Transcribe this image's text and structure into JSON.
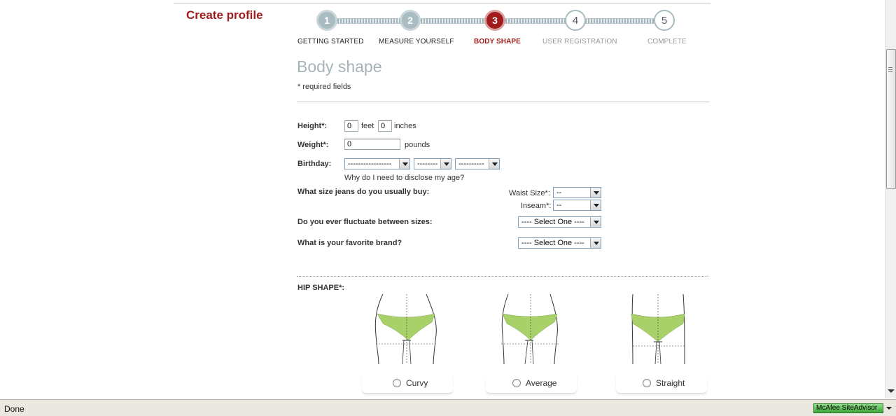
{
  "page": {
    "create_title": "Create profile",
    "section_title": "Body shape",
    "required_note": "* required fields"
  },
  "steps": [
    {
      "number": "1",
      "label": "GETTING STARTED",
      "state": "done"
    },
    {
      "number": "2",
      "label": "MEASURE YOURSELF",
      "state": "done"
    },
    {
      "number": "3",
      "label": "BODY SHAPE",
      "state": "active"
    },
    {
      "number": "4",
      "label": "USER REGISTRATION",
      "state": "todo"
    },
    {
      "number": "5",
      "label": "COMPLETE",
      "state": "todo"
    }
  ],
  "form": {
    "height_label": "Height*:",
    "height_feet_value": "0",
    "feet_unit": "feet",
    "height_inches_value": "0",
    "inches_unit": "inches",
    "weight_label": "Weight*:",
    "weight_value": "0",
    "weight_unit": "pounds",
    "birthday_label": "Birthday:",
    "birthday_month": "-----------------",
    "birthday_day": "--------",
    "birthday_year": "----------",
    "age_link": "Why do I need to disclose my age?",
    "jeans_label": "What size jeans do you usually buy:",
    "waist_label": "Waist Size*:",
    "waist_value": "--",
    "inseam_label": "Inseam*:",
    "inseam_value": "--",
    "fluctuate_label": "Do you ever fluctuate between sizes:",
    "fluctuate_value": "---- Select One ----",
    "brand_label": "What is your favorite brand?",
    "brand_value": "---- Select One ----"
  },
  "hip": {
    "label": "HIP SHAPE*:",
    "options": [
      "Curvy",
      "Average",
      "Straight"
    ],
    "accent_color": "#a9d16a"
  },
  "statusbar": {
    "text": "Done",
    "addon": "McAfee SiteAdvisor"
  },
  "colors": {
    "brand_red": "#a01c1c",
    "step_grey": "#a9bcc2",
    "title_grey": "#a6b4b9"
  }
}
